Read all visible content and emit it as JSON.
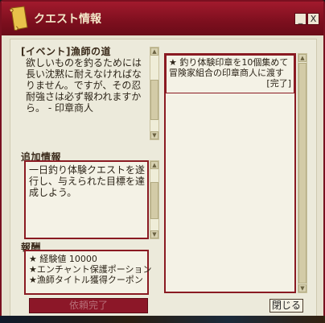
{
  "window": {
    "title": "クエスト情報",
    "minimize_label": "_",
    "close_label": "X"
  },
  "quest": {
    "header": "[イベント]漁師の道",
    "description": "欲しいものを釣るためには長い沈黙に耐えなければなりません。ですが、その忍耐強さは必ず報われますから。 - 印章商人"
  },
  "extra_info": {
    "header": "追加情報",
    "text": "一日釣り体験クエストを遂行し、与えられた目標を達成しよう。"
  },
  "rewards": {
    "header": "報酬",
    "items": [
      {
        "label": "★ 経験値",
        "value": "10000"
      },
      {
        "label": "★エンチャント保護ポーション",
        "value": ""
      },
      {
        "label": "★漁師タイトル獲得クーポン",
        "value": ""
      }
    ]
  },
  "objectives": {
    "lines": [
      "★ 釣り体験印章を10個集めて",
      "冒険家組合の印章商人に渡す",
      "[完了]"
    ]
  },
  "buttons": {
    "complete_label": "依頼完了",
    "close_label": "閉じる"
  }
}
